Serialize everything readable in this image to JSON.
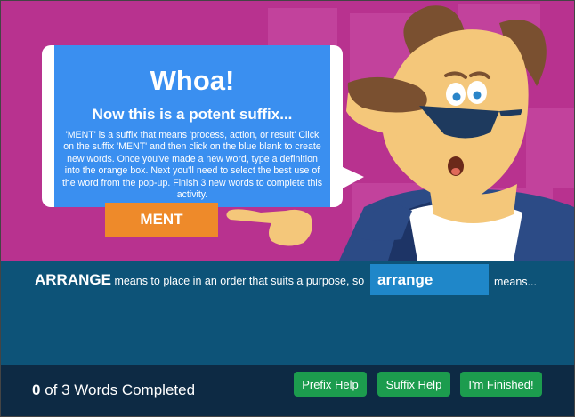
{
  "bubble": {
    "title": "Whoa!",
    "subtitle": "Now this is a potent suffix...",
    "instructions": "'MENT' is a suffix that means 'process, action, or result' Click on the suffix 'MENT' and then click on the blue blank to create new words. Once you've made a new word, type a definition into the orange box. Next you'll need to select the best use of the word from the pop-up. Finish 3 new words to complete this activity."
  },
  "suffix": {
    "label": "MENT"
  },
  "sentence": {
    "root_word": "ARRANGE",
    "definition": "means to place in an order that suits a purpose, so",
    "blank_word": "arrange",
    "trailing": "means..."
  },
  "footer": {
    "completed": "0",
    "progress_text": "of 3 Words Completed",
    "prefix_help_label": "Prefix Help",
    "suffix_help_label": "Suffix Help",
    "finished_label": "I'm Finished!"
  },
  "colors": {
    "scene_bg": "#b8328f",
    "bubble_blue": "#3a8ff0",
    "suffix_orange": "#ee8a2a",
    "panel_blue": "#0d5378",
    "footer_navy": "#0d2a44",
    "button_green": "#1c9c4e"
  }
}
